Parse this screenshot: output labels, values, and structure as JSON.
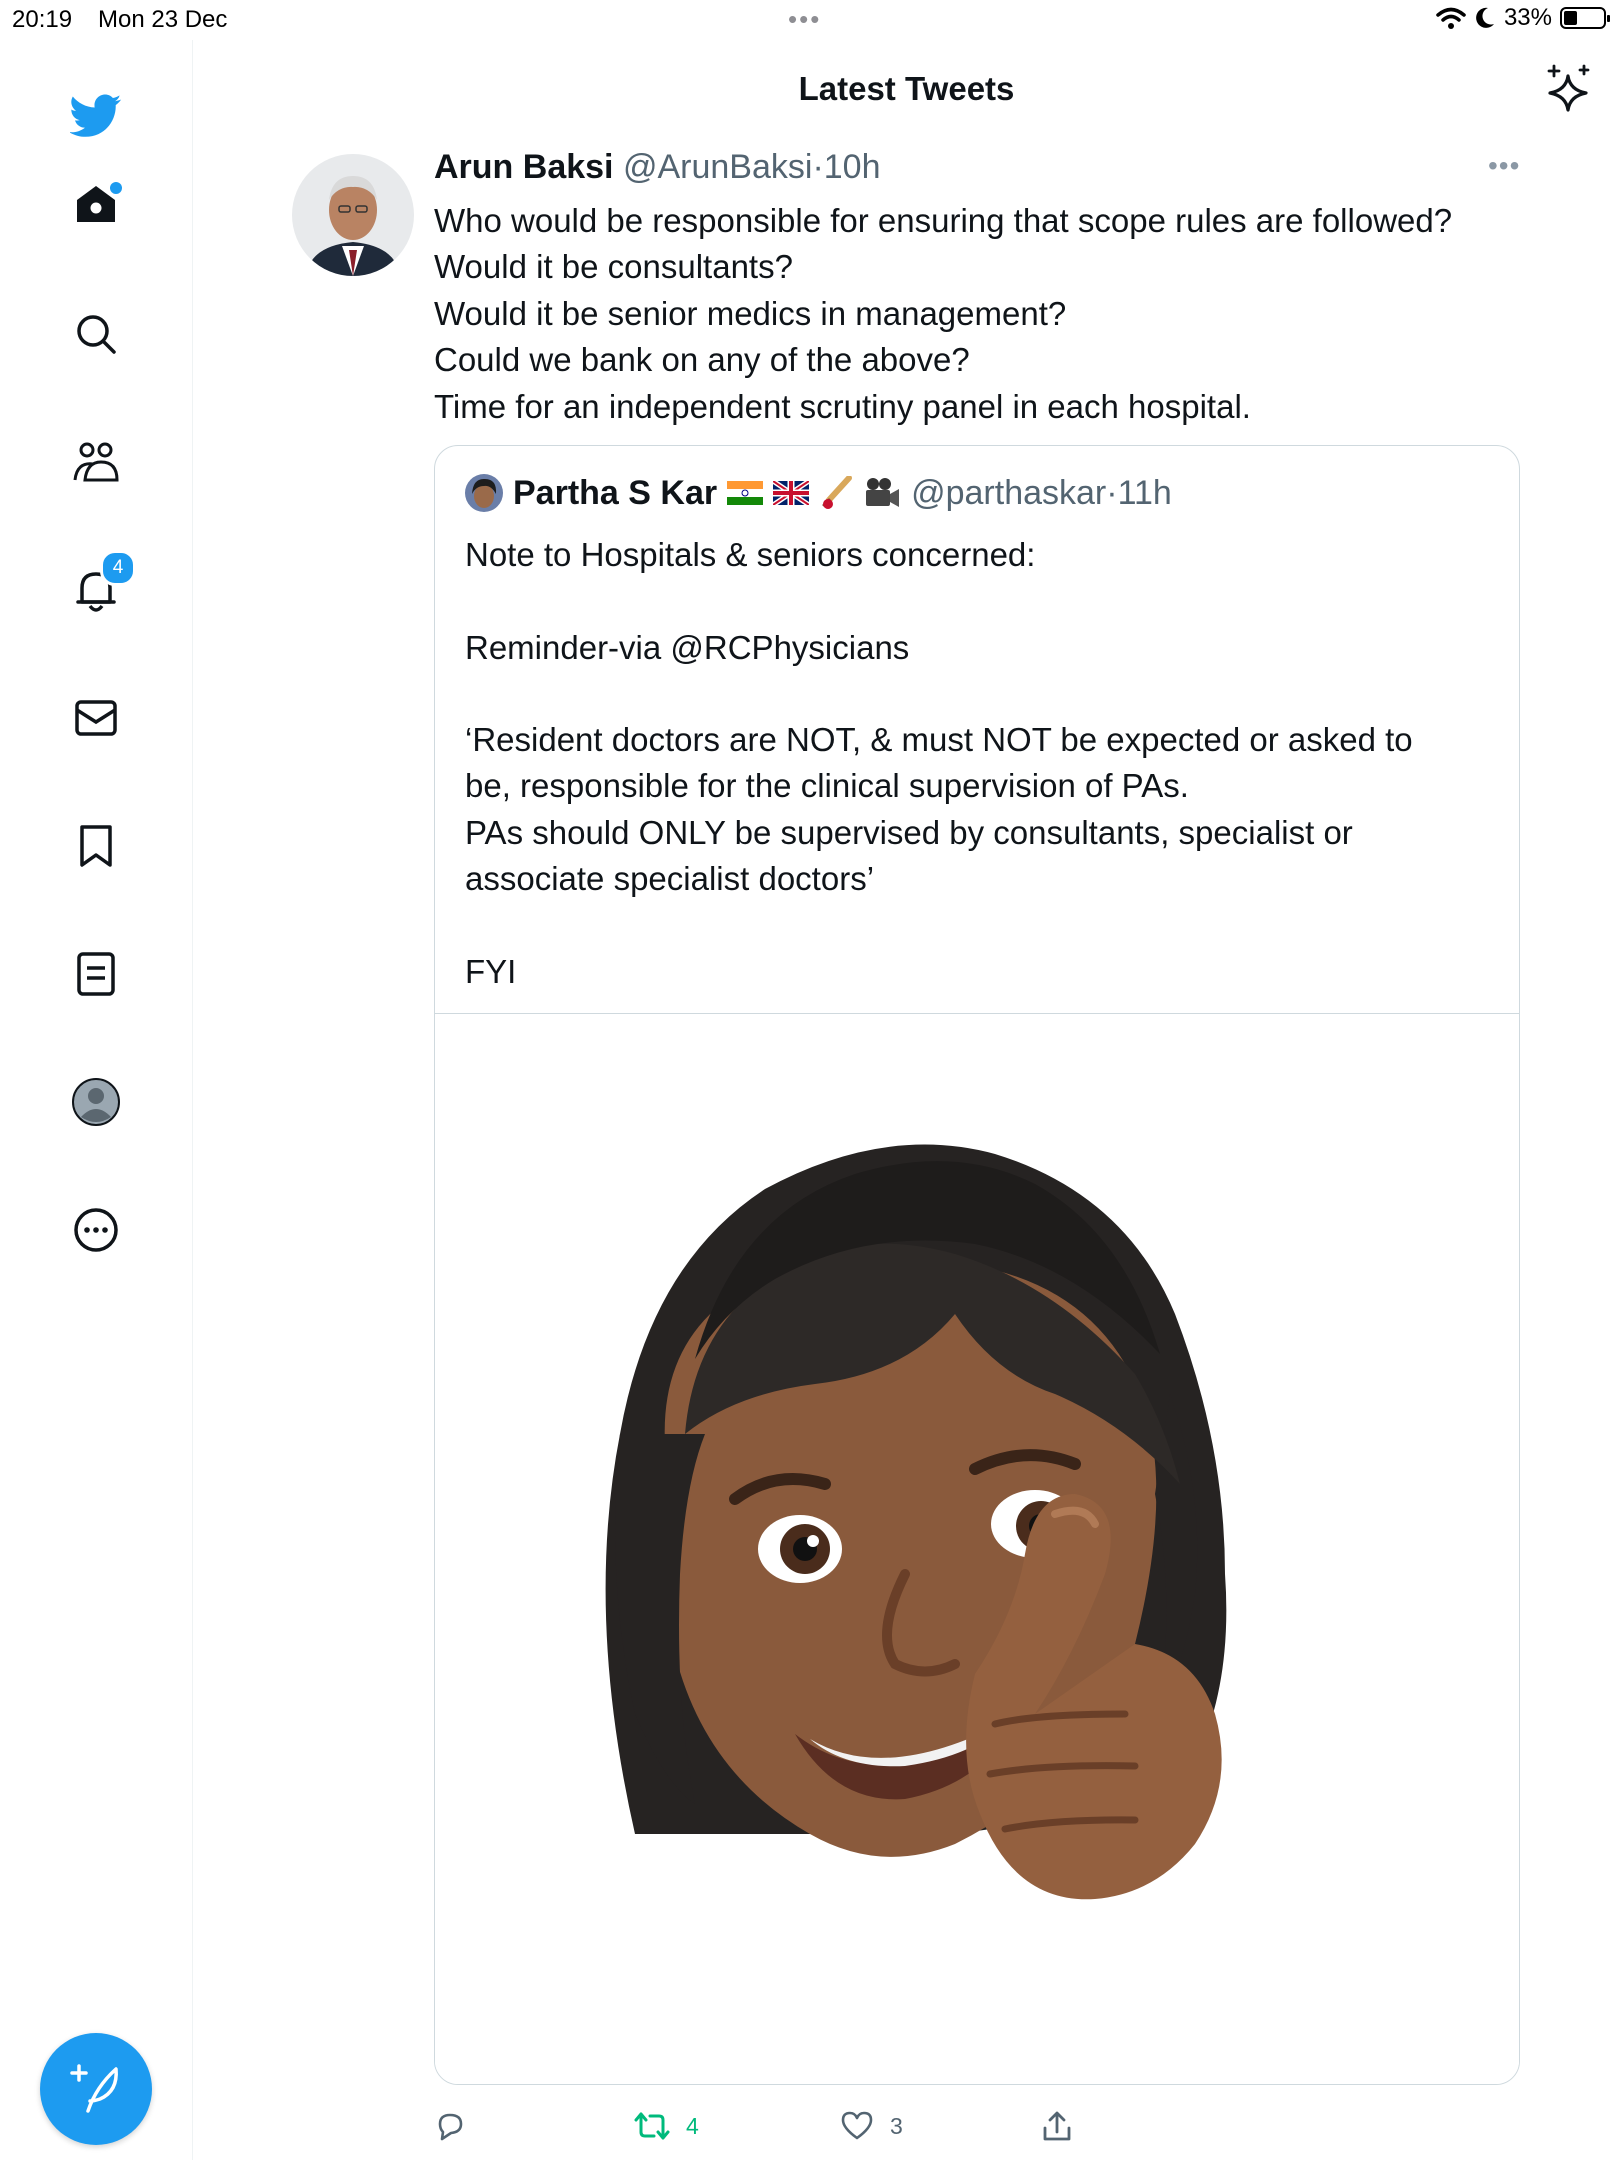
{
  "status_bar": {
    "time": "20:19",
    "date": "Mon 23 Dec",
    "battery": "33%",
    "battery_level": 0.33
  },
  "header": {
    "title": "Latest Tweets"
  },
  "sidebar": {
    "items": [
      {
        "icon": "home-icon",
        "has_dot": true
      },
      {
        "icon": "search-icon"
      },
      {
        "icon": "communities-icon"
      },
      {
        "icon": "notifications-icon",
        "badge": "4"
      },
      {
        "icon": "messages-icon"
      },
      {
        "icon": "bookmarks-icon"
      },
      {
        "icon": "lists-icon"
      },
      {
        "icon": "profile-icon"
      },
      {
        "icon": "more-icon"
      }
    ],
    "compose_icon": "compose-tweet-icon"
  },
  "tweet": {
    "author_name": "Arun Baksi",
    "handle": "@ArunBaksi",
    "time": "10h",
    "text_lines": [
      "Who would be responsible for ensuring that scope rules are followed?",
      "Would it be consultants?",
      "Would it be senior medics in management?",
      "Could we bank on any of the above?",
      "Time for an independent scrutiny panel in each hospital."
    ],
    "quoted": {
      "author_name": "Partha S Kar",
      "emojis": "🇮🇳 🇬🇧 🏏 🎥",
      "handle": "@parthaskar",
      "time": "11h",
      "text_lines": [
        "Note to Hospitals & seniors concerned:",
        "",
        "Reminder-via @RCPhysicians",
        "",
        "‘Resident doctors are NOT, & must NOT be expected or asked to",
        "be, responsible for the clinical supervision of PAs.",
        "PAs should ONLY be supervised by consultants, specialist or",
        "associate specialist doctors’",
        "",
        "FYI"
      ],
      "media": "memoji-thumbs-up"
    },
    "actions": {
      "replies": "",
      "retweets": "4",
      "likes": "3"
    }
  },
  "colors": {
    "accent": "#1d9bf0",
    "retweet": "#00ba7c",
    "secondary_text": "#536471"
  }
}
